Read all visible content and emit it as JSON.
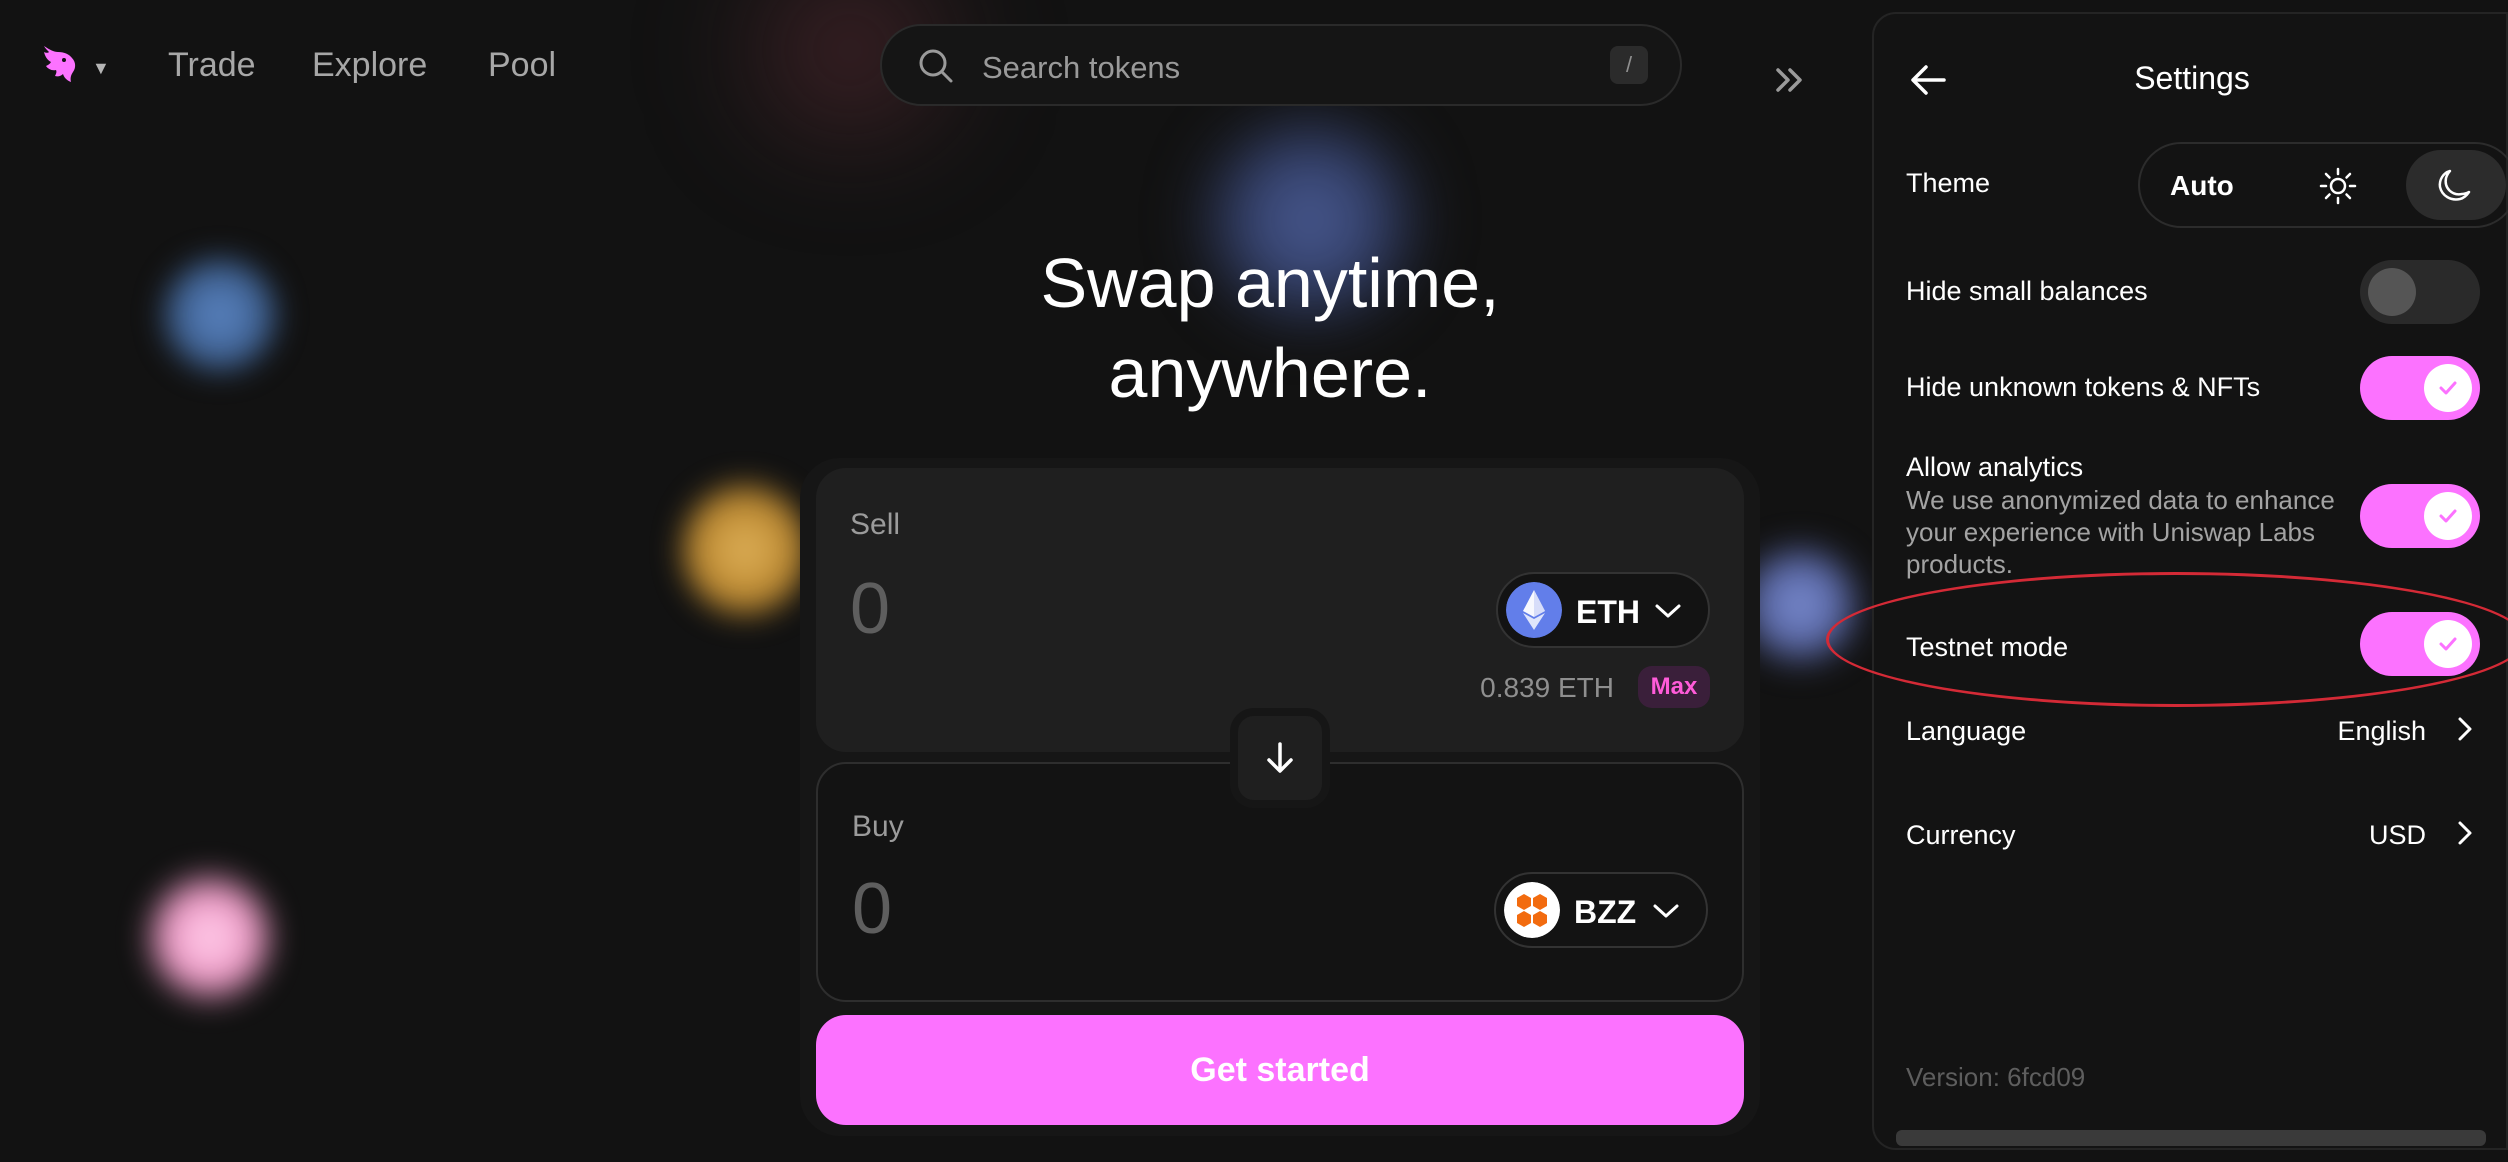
{
  "nav": {
    "links": [
      "Trade",
      "Explore",
      "Pool"
    ]
  },
  "search": {
    "placeholder": "Search tokens",
    "shortcut": "/"
  },
  "hero": {
    "line1": "Swap anytime,",
    "line2": "anywhere."
  },
  "swap": {
    "sell": {
      "label": "Sell",
      "amount": "0",
      "token": "ETH",
      "balance": "0.839 ETH",
      "max_label": "Max"
    },
    "buy": {
      "label": "Buy",
      "amount": "0",
      "token": "BZZ"
    },
    "cta": "Get started"
  },
  "settings": {
    "title": "Settings",
    "theme": {
      "label": "Theme",
      "options": [
        "Auto",
        "sun-icon",
        "moon-icon"
      ],
      "auto_label": "Auto",
      "selected": "moon-icon"
    },
    "hide_small_balances": {
      "label": "Hide small balances",
      "enabled": false
    },
    "hide_unknown": {
      "label": "Hide unknown tokens & NFTs",
      "enabled": true
    },
    "analytics": {
      "label": "Allow analytics",
      "description": "We use anonymized data to enhance your experience with Uniswap Labs products.",
      "enabled": true
    },
    "testnet": {
      "label": "Testnet mode",
      "enabled": true
    },
    "language": {
      "label": "Language",
      "value": "English"
    },
    "currency": {
      "label": "Currency",
      "value": "USD"
    },
    "version": "Version: 6fcd09"
  },
  "colors": {
    "accent": "#fc72ff",
    "background": "#131313",
    "annotation": "#d42a36"
  }
}
